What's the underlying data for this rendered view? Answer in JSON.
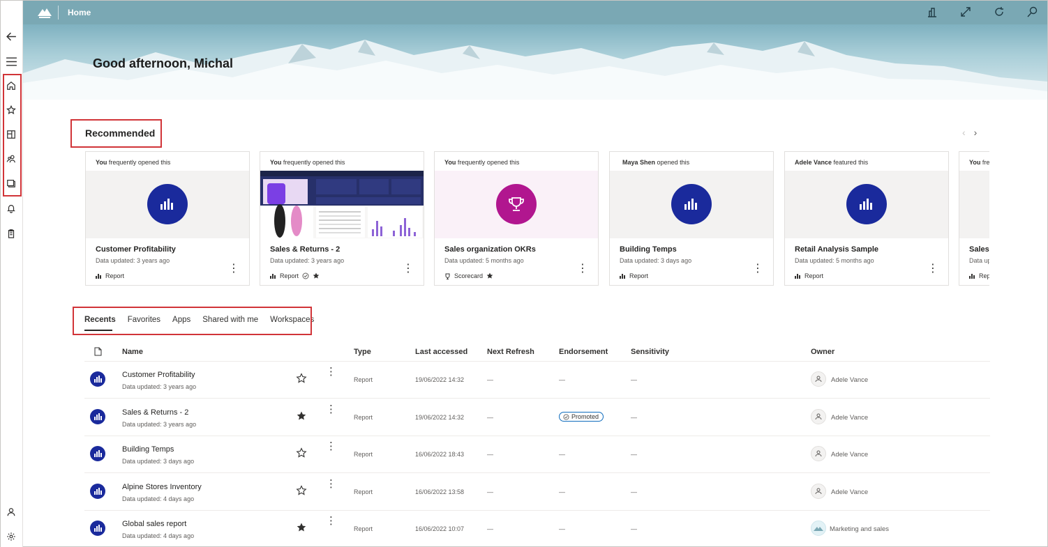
{
  "header": {
    "title": "Home"
  },
  "greeting": "Good afternoon, Michal",
  "recommended": {
    "title": "Recommended",
    "cards": [
      {
        "who": "You",
        "action": "frequently opened this",
        "title": "Customer Profitability",
        "updated": "Data updated: 3 years ago",
        "type": "Report"
      },
      {
        "who": "You",
        "action": "frequently opened this",
        "title": "Sales & Returns  - 2",
        "updated": "Data updated: 3 years ago",
        "type": "Report"
      },
      {
        "who": "You",
        "action": "frequently opened this",
        "title": "Sales organization OKRs",
        "updated": "Data updated: 5 months ago",
        "type": "Scorecard"
      },
      {
        "who": "Maya Shen",
        "action": "opened this",
        "title": "Building Temps",
        "updated": "Data updated: 3 days ago",
        "type": "Report"
      },
      {
        "who": "Adele Vance",
        "action": "featured this",
        "title": "Retail Analysis Sample",
        "updated": "Data updated: 5 months ago",
        "type": "Report"
      },
      {
        "who": "You",
        "action": "fre",
        "title": "Sales p",
        "updated": "Data up",
        "type": "Repo"
      }
    ]
  },
  "tabs": [
    "Recents",
    "Favorites",
    "Apps",
    "Shared with me",
    "Workspaces"
  ],
  "table": {
    "columns": {
      "name": "Name",
      "type": "Type",
      "last": "Last accessed",
      "refresh": "Next Refresh",
      "endorsement": "Endorsement",
      "sensitivity": "Sensitivity",
      "owner": "Owner"
    },
    "rows": [
      {
        "name": "Customer Profitability",
        "sub": "Data updated: 3 years ago",
        "favorite": false,
        "type": "Report",
        "last": "19/06/2022 14:32",
        "refresh": "—",
        "endorsement": "—",
        "sensitivity": "—",
        "owner": "Adele Vance"
      },
      {
        "name": "Sales & Returns  - 2",
        "sub": "Data updated: 3 years ago",
        "favorite": true,
        "type": "Report",
        "last": "19/06/2022 14:32",
        "refresh": "—",
        "endorsement": "Promoted",
        "sensitivity": "—",
        "owner": "Adele Vance"
      },
      {
        "name": "Building Temps",
        "sub": "Data updated: 3 days ago",
        "favorite": false,
        "type": "Report",
        "last": "16/06/2022 18:43",
        "refresh": "—",
        "endorsement": "—",
        "sensitivity": "—",
        "owner": "Adele Vance"
      },
      {
        "name": "Alpine Stores Inventory",
        "sub": "Data updated: 4 days ago",
        "favorite": false,
        "type": "Report",
        "last": "16/06/2022 13:58",
        "refresh": "—",
        "endorsement": "—",
        "sensitivity": "—",
        "owner": "Adele Vance"
      },
      {
        "name": "Global sales report",
        "sub": "Data updated: 4 days ago",
        "favorite": true,
        "type": "Report",
        "last": "16/06/2022 10:07",
        "refresh": "—",
        "endorsement": "—",
        "sensitivity": "—",
        "owner": "Marketing and sales"
      }
    ]
  },
  "colors": {
    "accent": "#1a2a9c",
    "header": "#7aa8b4",
    "highlight": "#d13438",
    "scorecard": "#b1168f"
  }
}
